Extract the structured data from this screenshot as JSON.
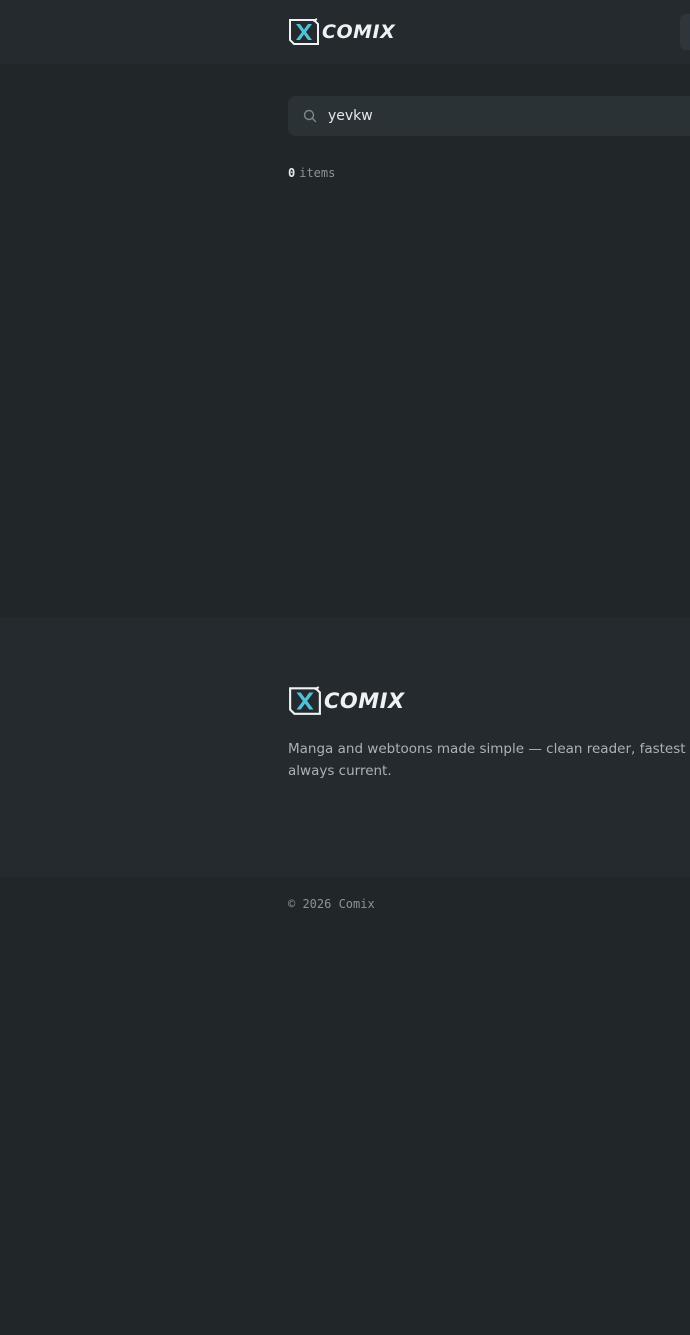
{
  "header": {
    "logo_text": "COMIX"
  },
  "search": {
    "value": "yevkw"
  },
  "results": {
    "count": "0",
    "label": "items"
  },
  "footer": {
    "logo_text": "COMIX",
    "tagline_line1": "Manga and webtoons made simple — clean reader, fastest upda",
    "tagline_line2": "always current.",
    "copyright": "© 2026 Comix"
  },
  "colors": {
    "background": "#212629",
    "surface": "#242a2e",
    "accent": "#4fc3d9"
  },
  "icons": {
    "logo": "comix-x-logo-icon",
    "search": "search-icon"
  }
}
